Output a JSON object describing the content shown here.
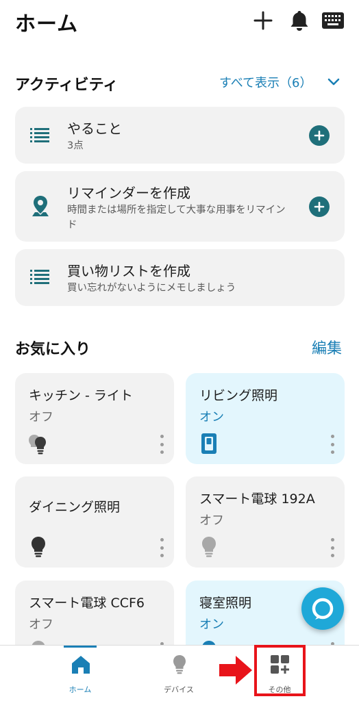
{
  "header": {
    "title": "ホーム",
    "icons": [
      "plus-icon",
      "bell-icon",
      "keyboard-icon"
    ]
  },
  "activity": {
    "title": "アクティビティ",
    "show_all": "すべて表示（6）",
    "items": [
      {
        "title": "やること",
        "subtitle": "3点",
        "icon": "list-icon"
      },
      {
        "title": "リマインダーを作成",
        "subtitle": "時間または場所を指定して大事な用事をリマインド",
        "icon": "location-pin-icon"
      },
      {
        "title": "買い物リストを作成",
        "subtitle": "買い忘れがないようにメモしましょう",
        "icon": "list-icon"
      }
    ]
  },
  "favorites": {
    "title": "お気に入り",
    "edit": "編集",
    "items": [
      {
        "name": "キッチン - ライト",
        "state": "オフ",
        "icon": "bulb-group-icon"
      },
      {
        "name": "リビング照明",
        "state": "オン",
        "icon": "switch-icon"
      },
      {
        "name": "ダイニング照明",
        "state": "",
        "icon": "bulb-icon"
      },
      {
        "name": "スマート電球 192A",
        "state": "オフ",
        "icon": "bulb-icon"
      },
      {
        "name": "スマート電球 CCF6",
        "state": "オフ",
        "icon": "bulb-icon"
      },
      {
        "name": "寝室照明",
        "state": "オン",
        "icon": "bulb-icon"
      }
    ]
  },
  "nav": {
    "items": [
      {
        "label": "ホーム",
        "icon": "home-icon",
        "active": true
      },
      {
        "label": "デバイス",
        "icon": "bulb-icon",
        "active": false
      },
      {
        "label": "その他",
        "icon": "more-grid-icon",
        "active": false
      }
    ]
  },
  "colors": {
    "accent": "#1a7fb5",
    "teal": "#1f6f7a",
    "card_off": "#f2f2f2",
    "card_on": "#e3f6fd",
    "alexa": "#1fa8d8",
    "highlight": "#e8141a"
  }
}
